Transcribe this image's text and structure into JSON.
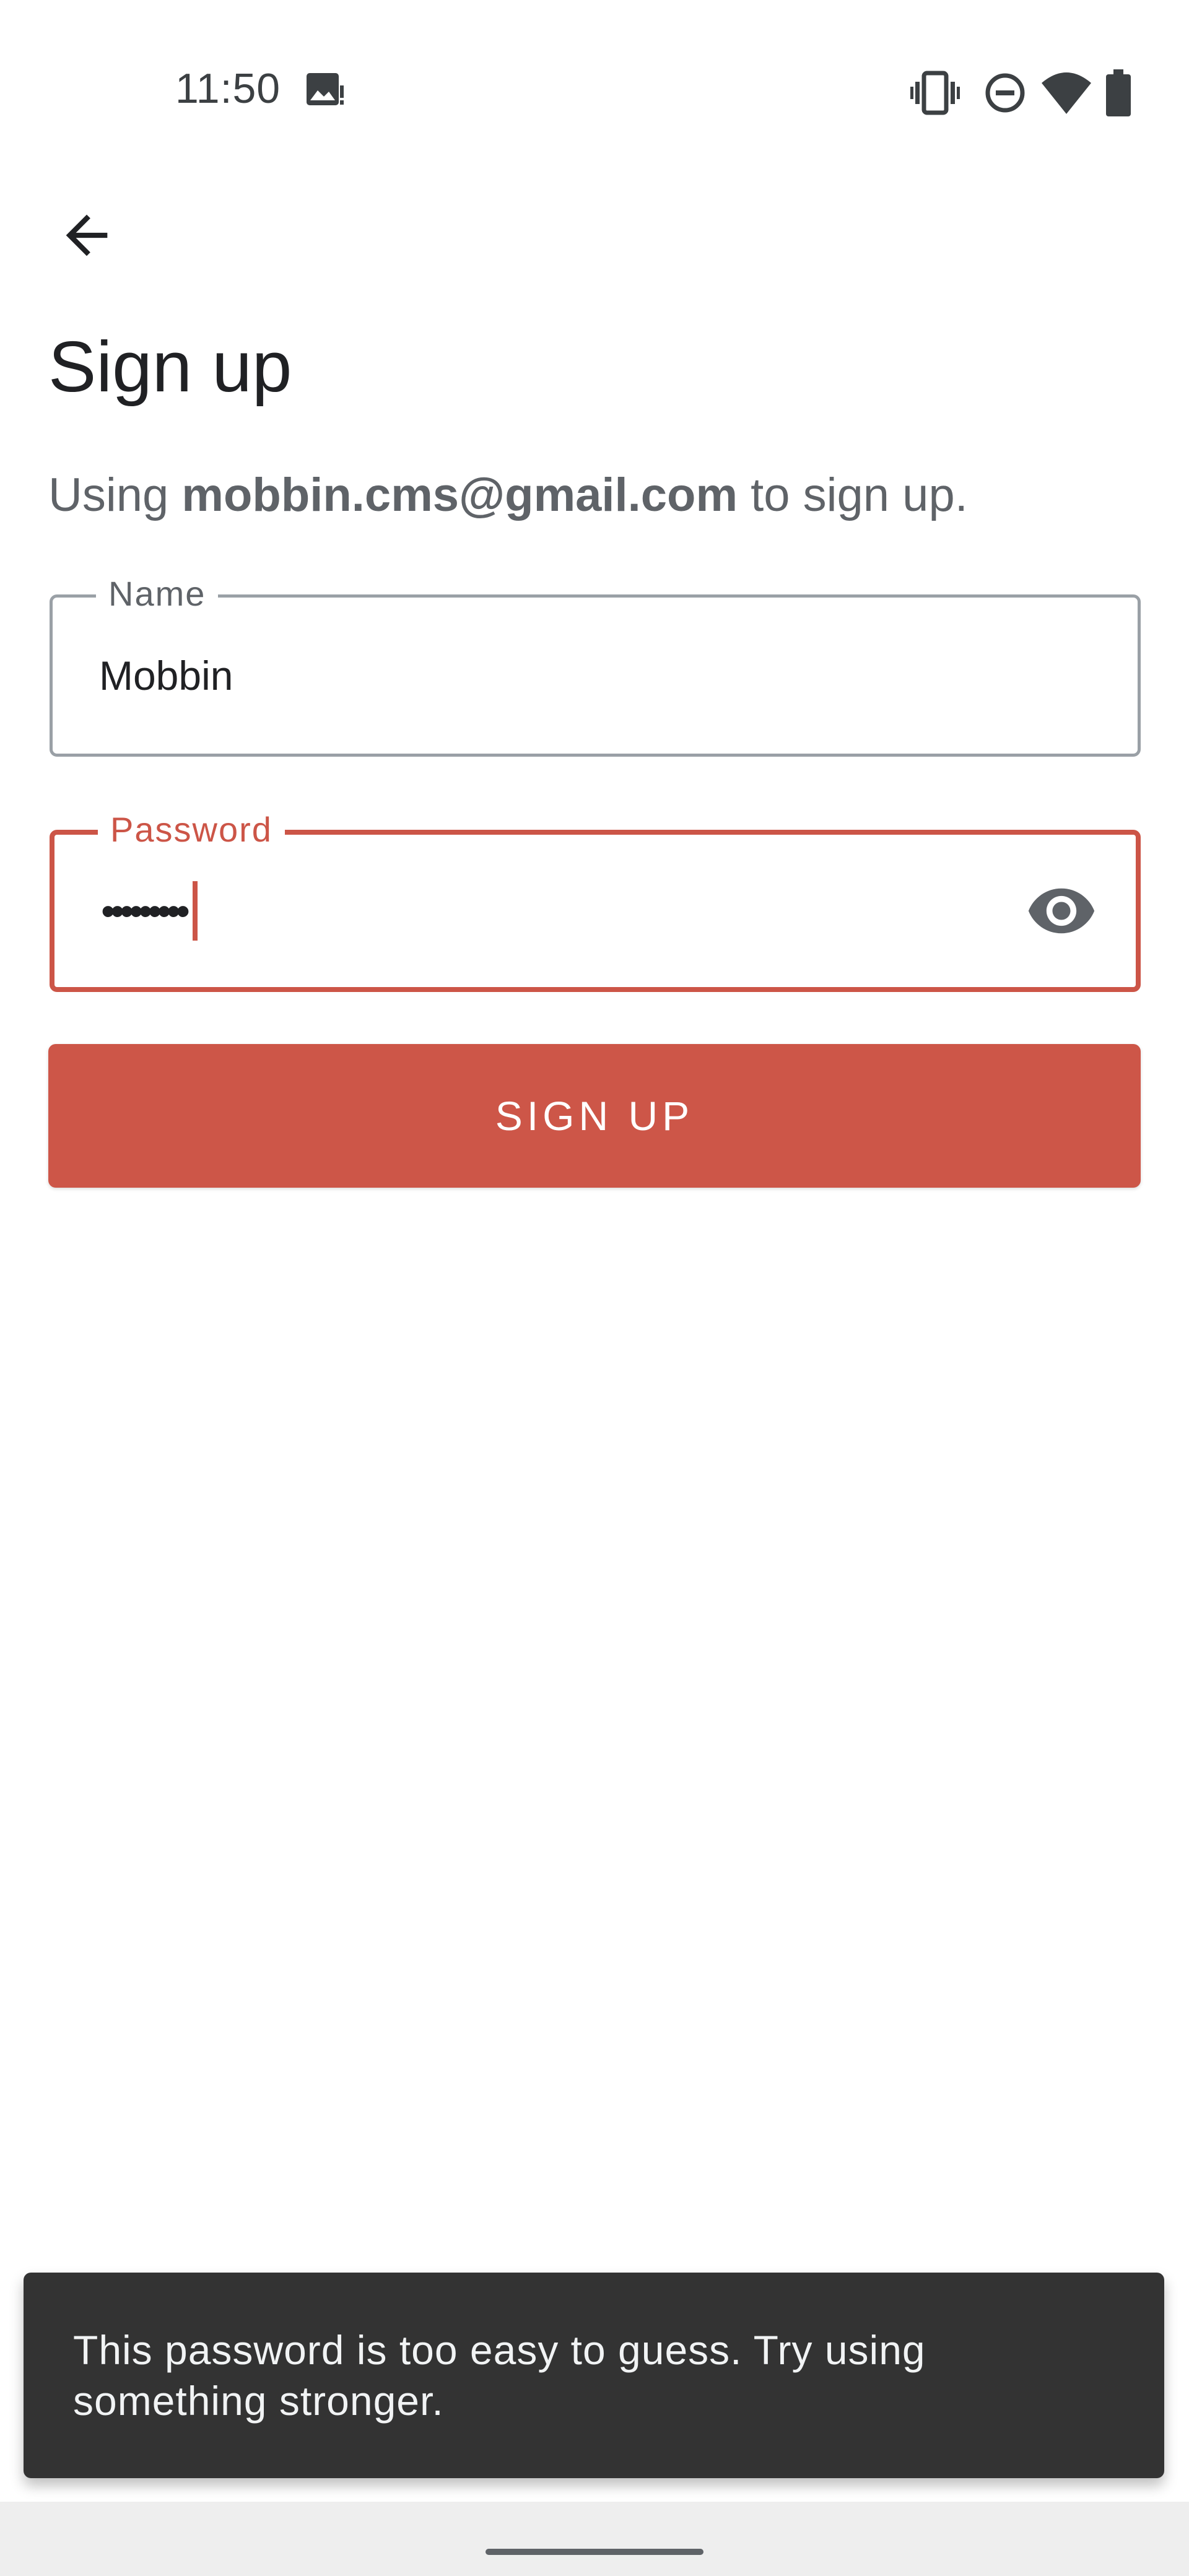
{
  "status_bar": {
    "time": "11:50",
    "icons": [
      "gallery-icon",
      "vibrate-icon",
      "do-not-disturb-icon",
      "wifi-icon",
      "battery-icon"
    ]
  },
  "header": {
    "back_icon": "arrow-left-icon",
    "title": "Sign up"
  },
  "subtitle": {
    "prefix": "Using ",
    "email": "mobbin.cms@gmail.com",
    "suffix": " to sign up."
  },
  "form": {
    "name": {
      "label": "Name",
      "value": "Mobbin"
    },
    "password": {
      "label": "Password",
      "masked_value": "•••••••••",
      "toggle_icon": "eye-icon"
    },
    "submit_label": "SIGN UP"
  },
  "snackbar": {
    "message": "This password is too easy to guess. Try using something stronger."
  },
  "colors": {
    "accent": "#cc5547",
    "snackbar_bg": "#333333",
    "text_primary": "#202124",
    "text_secondary": "#5f6368"
  }
}
